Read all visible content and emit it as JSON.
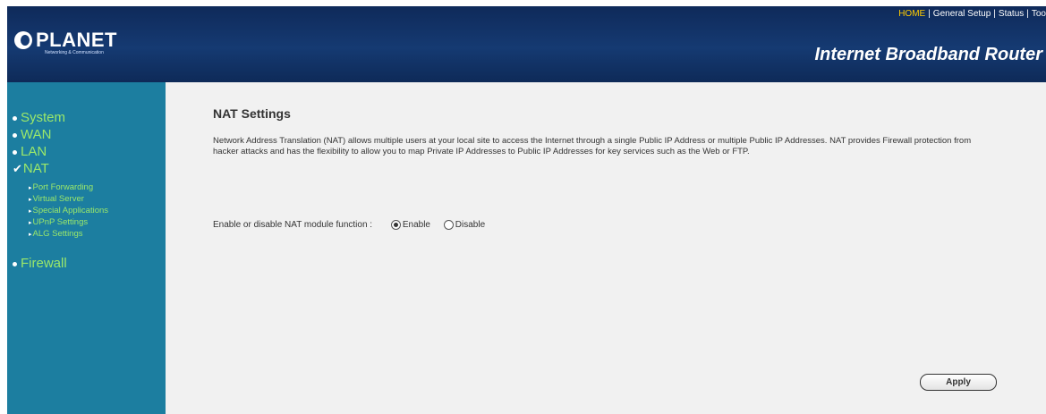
{
  "header": {
    "brand": "PLANET",
    "tagline": "Networking & Communication",
    "nav": [
      {
        "label": "HOME",
        "active": true
      },
      {
        "label": "General Setup",
        "active": false
      },
      {
        "label": "Status",
        "active": false
      },
      {
        "label": "Too",
        "active": false
      }
    ],
    "product_title": "Internet Broadband Router"
  },
  "sidebar": {
    "items": [
      {
        "label": "System",
        "marker": "bullet"
      },
      {
        "label": "WAN",
        "marker": "bullet"
      },
      {
        "label": "LAN",
        "marker": "bullet"
      },
      {
        "label": "NAT",
        "marker": "check",
        "selected": true
      },
      {
        "label": "Firewall",
        "marker": "bullet"
      }
    ],
    "nat_subitems": [
      {
        "label": "Port Forwarding"
      },
      {
        "label": "Virtual Server"
      },
      {
        "label": "Special Applications"
      },
      {
        "label": "UPnP Settings"
      },
      {
        "label": "ALG Settings"
      }
    ]
  },
  "main": {
    "title": "NAT Settings",
    "description": "Network Address Translation (NAT) allows multiple users at your local site to access the Internet through a single Public IP Address or multiple Public IP Addresses. NAT provides Firewall protection from hacker attacks and has the flexibility to allow you to map Private IP Addresses to Public IP Addresses for key services such as the Web or FTP.",
    "nat_label": "Enable or disable NAT module function :",
    "options": [
      {
        "label": "Enable",
        "checked": true
      },
      {
        "label": "Disable",
        "checked": false
      }
    ],
    "apply_label": "Apply"
  },
  "colors": {
    "header_bg": "#153a72",
    "sidebar_bg": "#1c7ea0",
    "menu_text": "#9be86a",
    "active_nav": "#ffcc00"
  }
}
